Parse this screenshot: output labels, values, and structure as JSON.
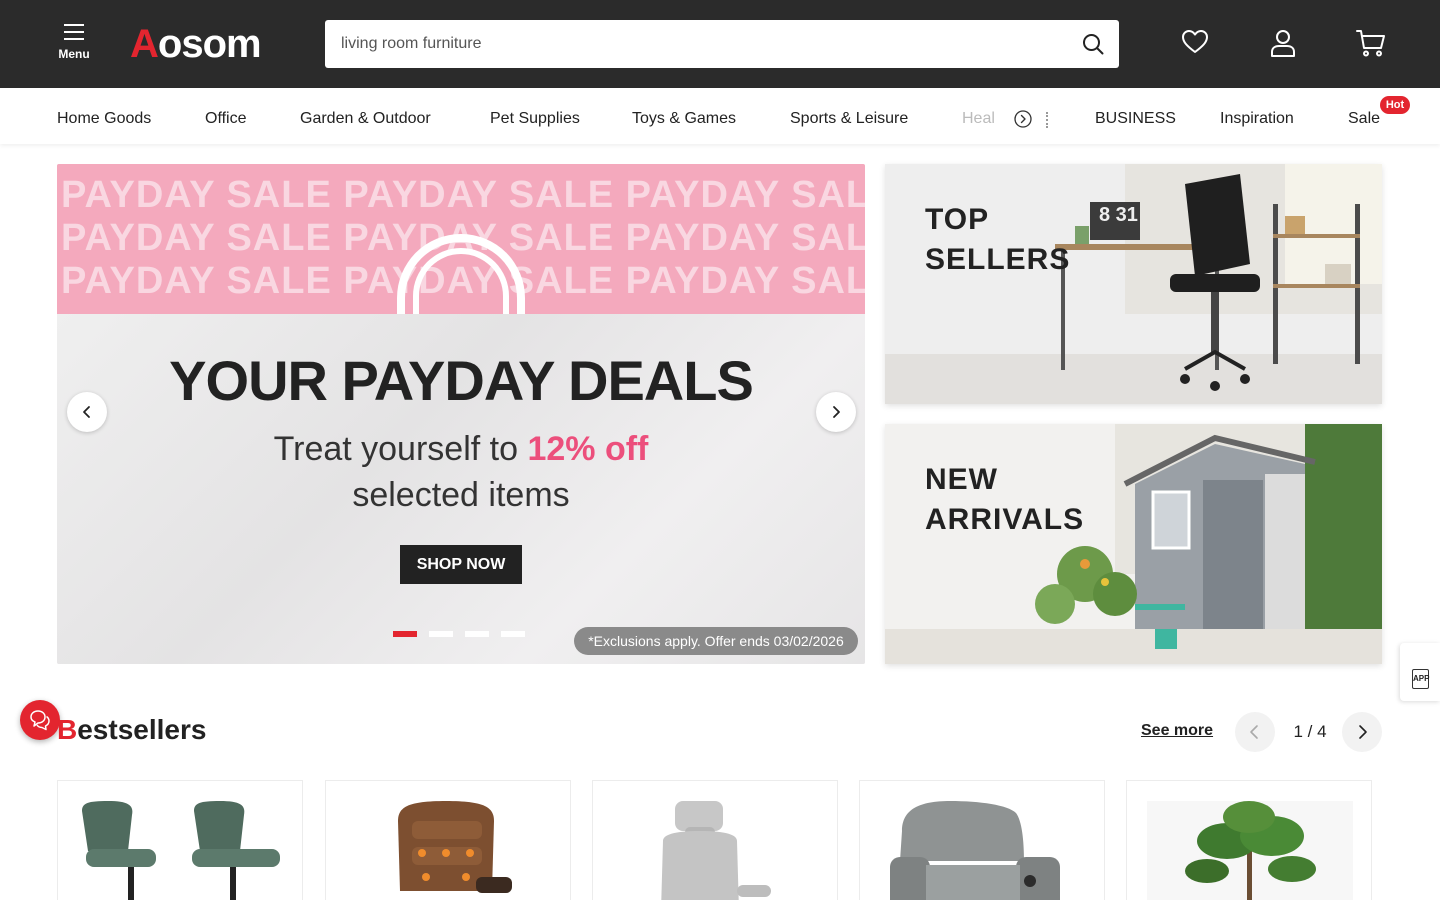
{
  "header": {
    "menu_label": "Menu",
    "logo_first": "A",
    "logo_rest": "osom",
    "search_value": "living room furniture",
    "search_placeholder": "living room furniture"
  },
  "nav": {
    "categories": [
      "Home Goods",
      "Office",
      "Garden & Outdoor",
      "Pet Supplies",
      "Toys & Games",
      "Sports & Leisure",
      "Heal"
    ],
    "right_links": [
      "BUSINESS",
      "Inspiration",
      "Sale"
    ],
    "hot_badge": "Hot"
  },
  "banner": {
    "pattern_text": "PAYDAY SALE PAYDAY SALE PAYDAY SALE",
    "headline": "YOUR PAYDAY DEALS",
    "sub_line1_prefix": "Treat yourself to ",
    "sub_line1_highlight": "12% off",
    "sub_line2": "selected items",
    "cta": "SHOP NOW",
    "disclaimer": "*Exclusions apply. Offer ends 03/02/2026",
    "slide_count": 4,
    "active_slide": 1
  },
  "promos": [
    {
      "line1": "TOP",
      "line2": "SELLERS",
      "clock_text": "8 31"
    },
    {
      "line1": "NEW",
      "line2": "ARRIVALS"
    }
  ],
  "bestsellers": {
    "title_first": "B",
    "title_rest": "estsellers",
    "see_more": "See more",
    "page_indicator": "1 / 4"
  },
  "app_tab_label": "APP",
  "colors": {
    "brand_red": "#e3252f",
    "header_bg": "#2b2b2b",
    "banner_pink": "#f4a9bd",
    "highlight_pink": "#ec4f7c"
  }
}
